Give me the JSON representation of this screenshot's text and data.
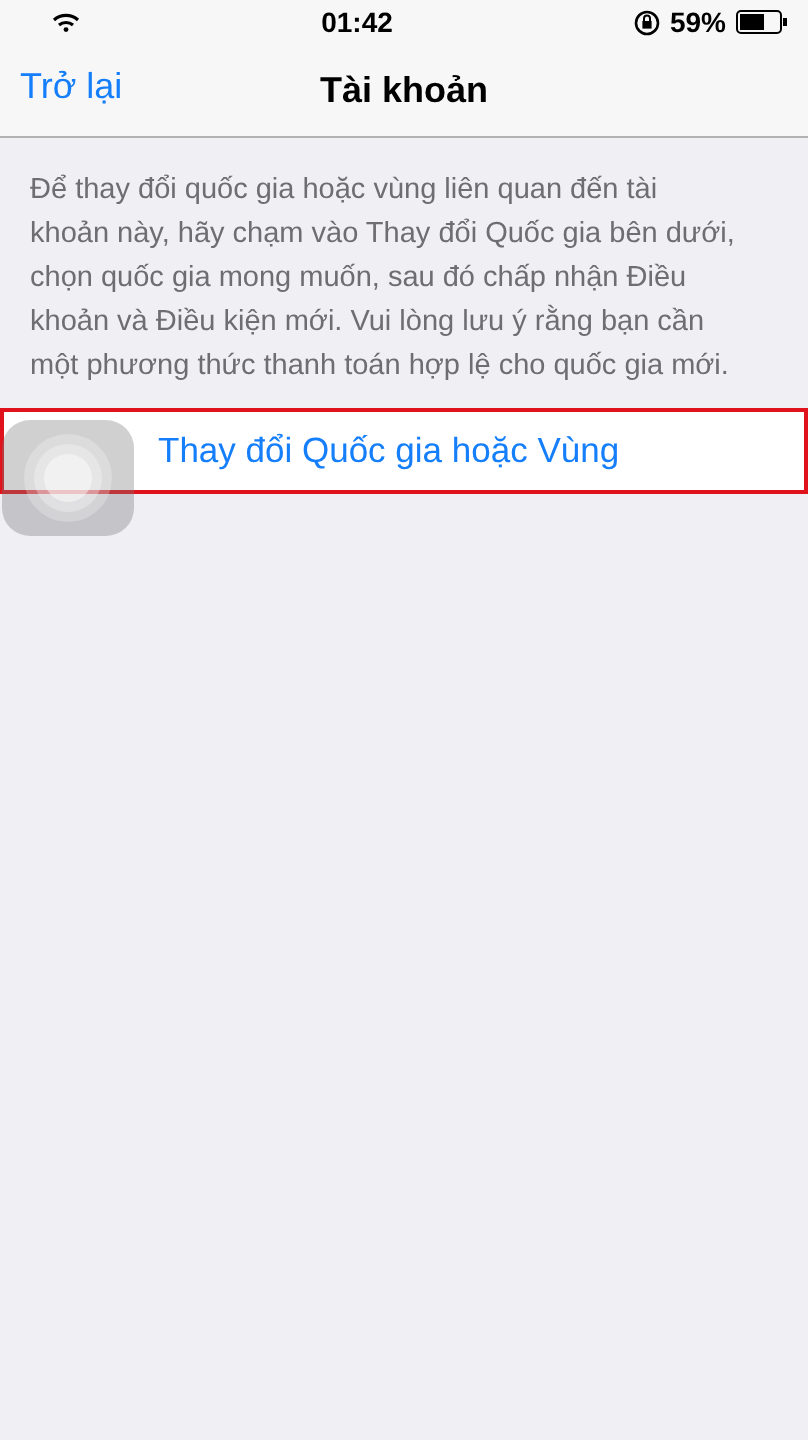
{
  "status_bar": {
    "time": "01:42",
    "battery": "59%"
  },
  "nav_bar": {
    "back": "Trở lại",
    "title": "Tài khoản"
  },
  "description": "Để thay đổi quốc gia hoặc vùng liên quan đến tài khoản này, hãy chạm vào Thay đổi Quốc gia bên dưới, chọn quốc gia mong muốn, sau đó chấp nhận Điều khoản và Điều kiện mới. Vui lòng lưu ý rằng bạn cần một phương thức thanh toán hợp lệ cho quốc gia mới.",
  "action": {
    "label": "Thay đổi Quốc gia hoặc Vùng",
    "highlighted": true
  }
}
